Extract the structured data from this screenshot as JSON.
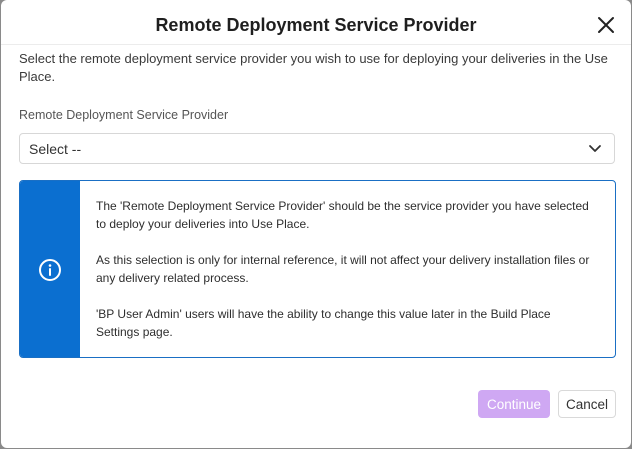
{
  "dialog": {
    "title": "Remote Deployment Service Provider",
    "description": "Select the remote deployment service provider you wish to use for deploying your deliveries in the Use Place.",
    "field_label": "Remote Deployment Service Provider",
    "select": {
      "value": "Select --"
    },
    "info": {
      "paragraphs": [
        "The 'Remote Deployment Service Provider' should be the service provider you have selected to deploy your deliveries into Use Place.",
        "As this selection is only for internal reference, it will not affect your delivery installation files or any delivery related process.",
        "'BP User Admin' users will have the ability to change this value later in the Build Place Settings page."
      ]
    },
    "buttons": {
      "continue": "Continue",
      "cancel": "Cancel"
    }
  },
  "colors": {
    "accent": "#0b6fd0",
    "continue_button": "#cfa8f3"
  },
  "icons": {
    "close": "close-icon",
    "chevron": "chevron-down-icon",
    "info": "info-icon"
  }
}
